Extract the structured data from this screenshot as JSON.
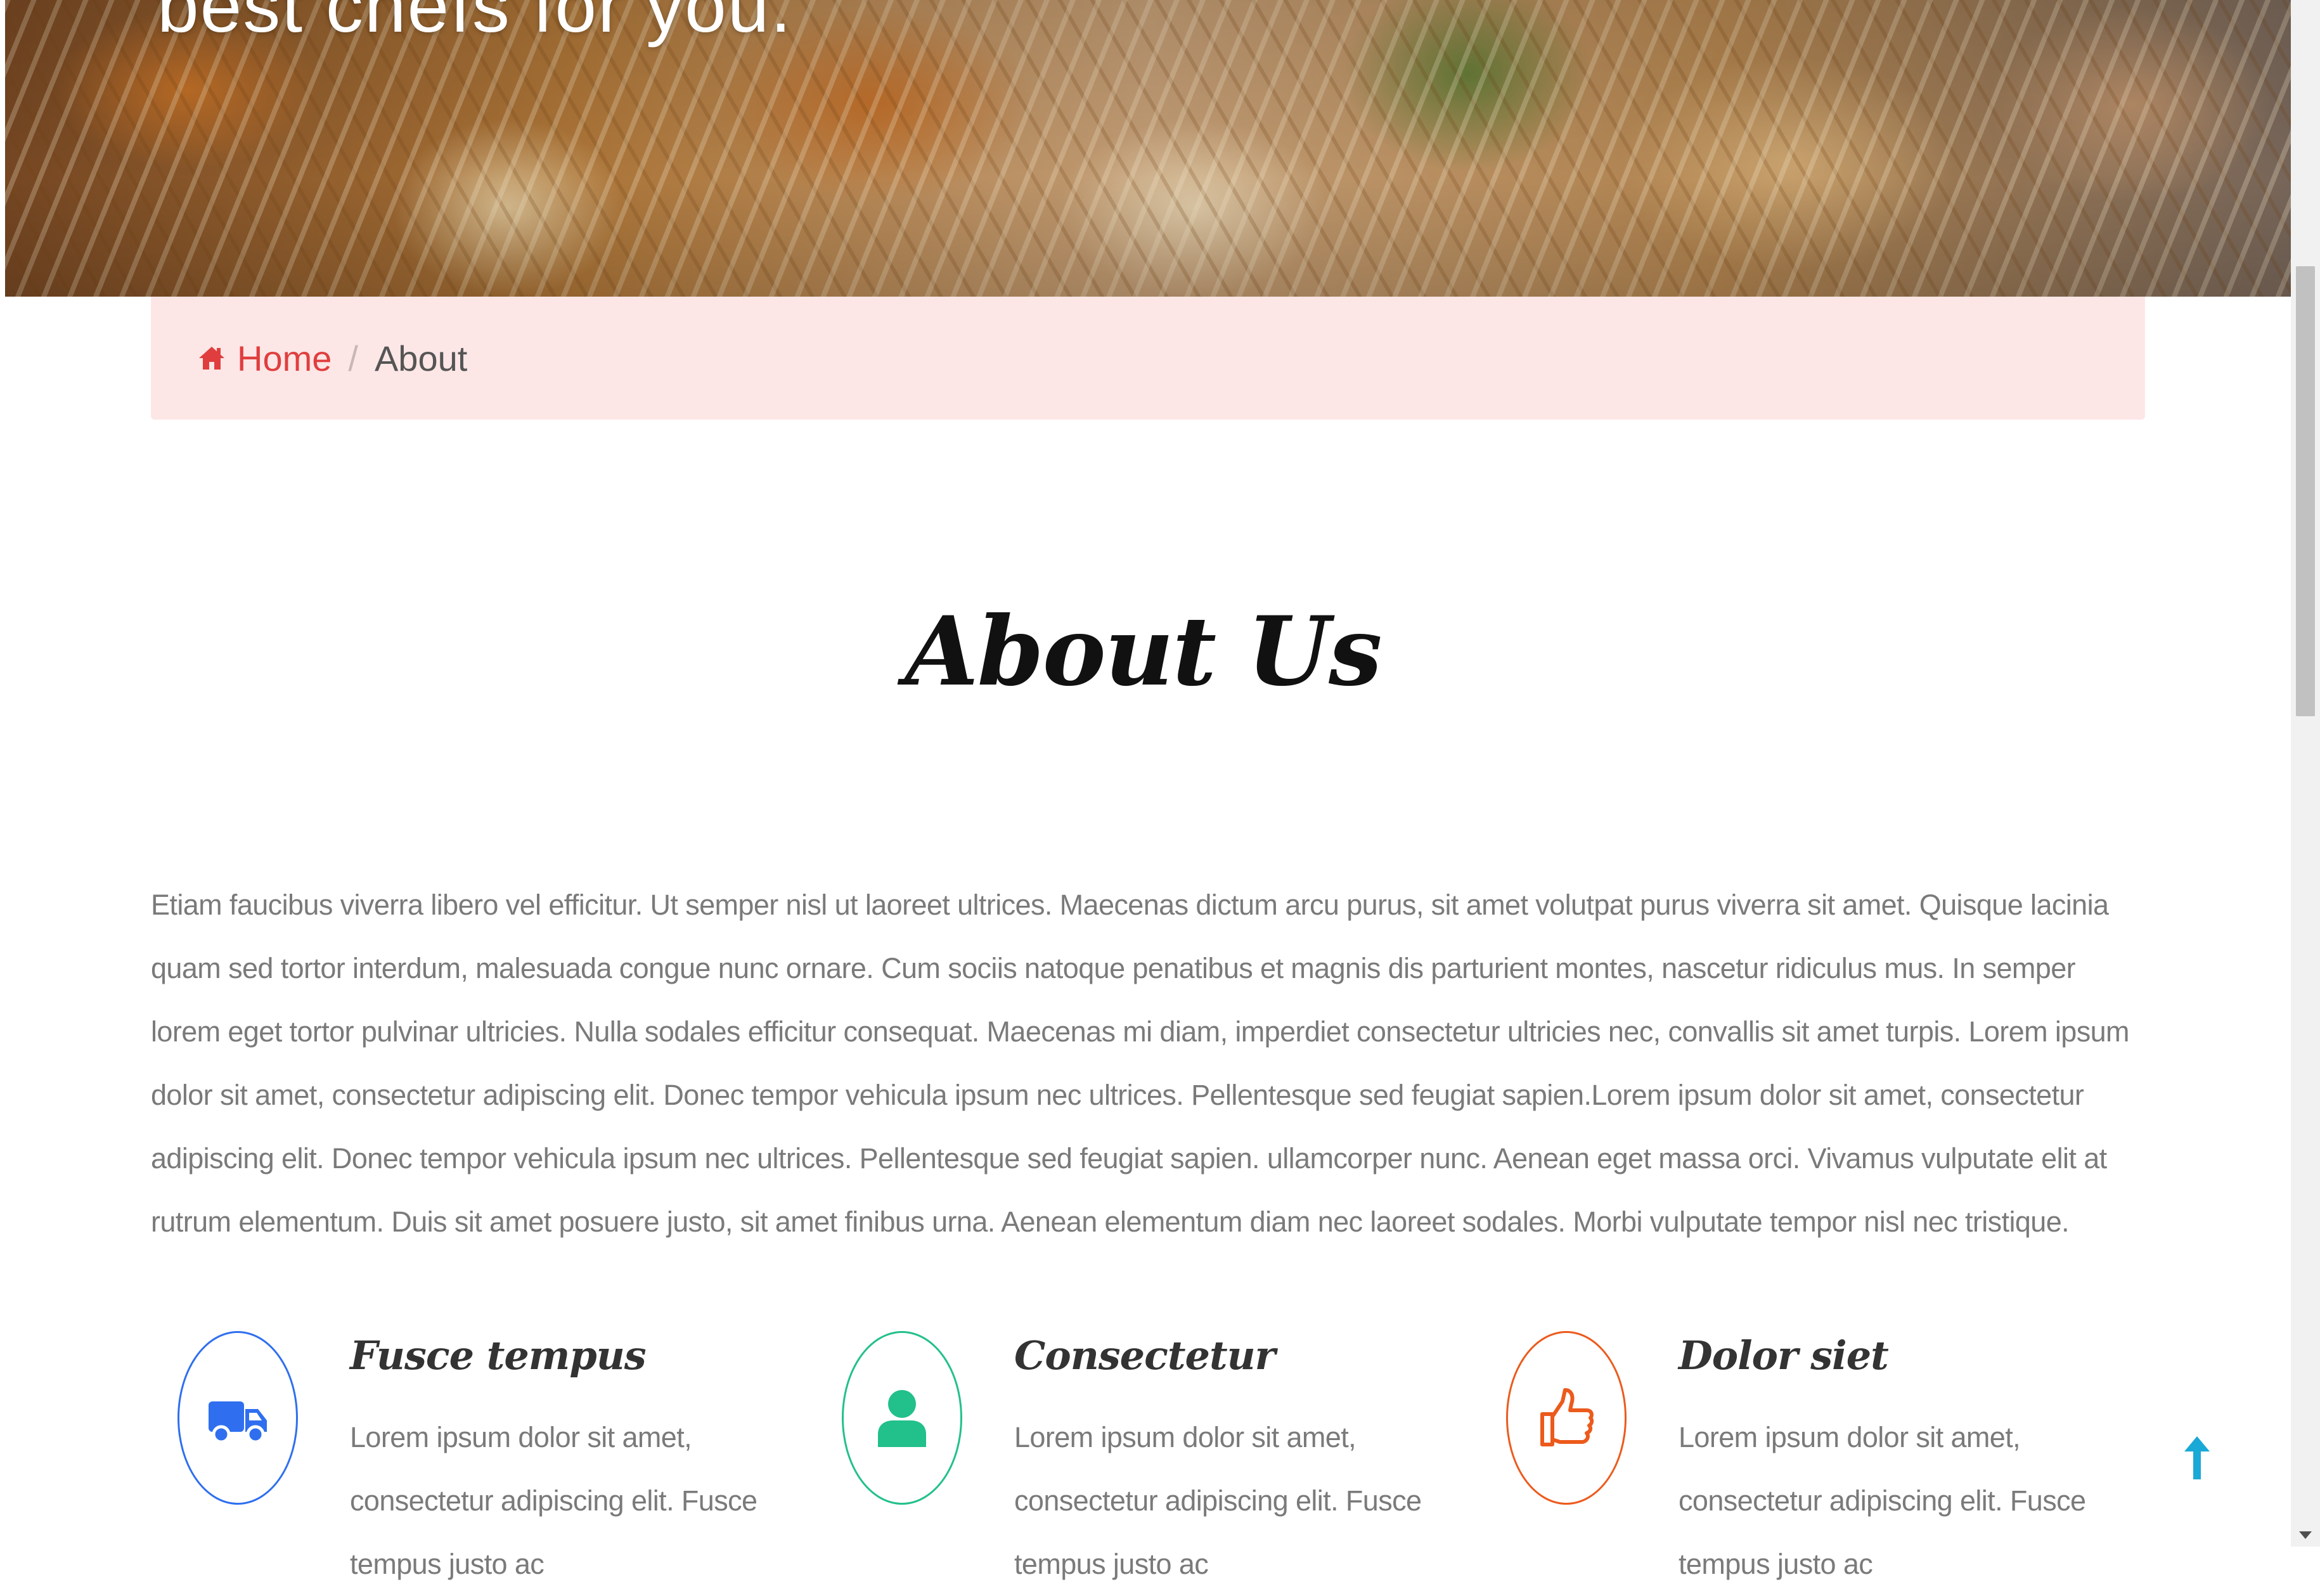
{
  "hero": {
    "tagline": "best chefs for you."
  },
  "breadcrumb": {
    "home_label": "Home",
    "separator": "/",
    "current_label": "About",
    "home_color": "#e03e3e",
    "background": "#fde6e6"
  },
  "about": {
    "title": "About Us",
    "paragraph": "Etiam faucibus viverra libero vel efficitur. Ut semper nisl ut laoreet ultrices. Maecenas dictum arcu purus, sit amet volutpat purus viverra sit amet. Quisque lacinia quam sed tortor interdum, malesuada congue nunc ornare. Cum sociis natoque penatibus et magnis dis parturient montes, nascetur ridiculus mus. In semper lorem eget tortor pulvinar ultricies. Nulla sodales efficitur consequat. Maecenas mi diam, imperdiet consectetur ultricies nec, convallis sit amet turpis. Lorem ipsum dolor sit amet, consectetur adipiscing elit. Donec tempor vehicula ipsum nec ultrices. Pellentesque sed feugiat sapien.Lorem ipsum dolor sit amet, consectetur adipiscing elit. Donec tempor vehicula ipsum nec ultrices. Pellentesque sed feugiat sapien. ullamcorper nunc. Aenean eget massa orci. Vivamus vulputate elit at rutrum elementum. Duis sit amet posuere justo, sit amet finibus urna. Aenean elementum diam nec laoreet sodales. Morbi vulputate tempor nisl nec tristique."
  },
  "features": [
    {
      "title": "Fusce tempus",
      "text": "Lorem ipsum dolor sit amet, consectetur adipiscing elit. Fusce tempus justo ac",
      "icon": "truck-icon",
      "color": "#2f6fef"
    },
    {
      "title": "Consectetur",
      "text": "Lorem ipsum dolor sit amet, consectetur adipiscing elit. Fusce tempus justo ac",
      "icon": "user-icon",
      "color": "#22c08a"
    },
    {
      "title": "Dolor siet",
      "text": "Lorem ipsum dolor sit amet, consectetur adipiscing elit. Fusce tempus justo ac",
      "icon": "thumbs-up-icon",
      "color": "#ec5a1c"
    }
  ],
  "back_to_top": {
    "icon": "arrow-up-icon",
    "color": "#19a9d6"
  },
  "scrollbar": {
    "position": 0.33
  }
}
